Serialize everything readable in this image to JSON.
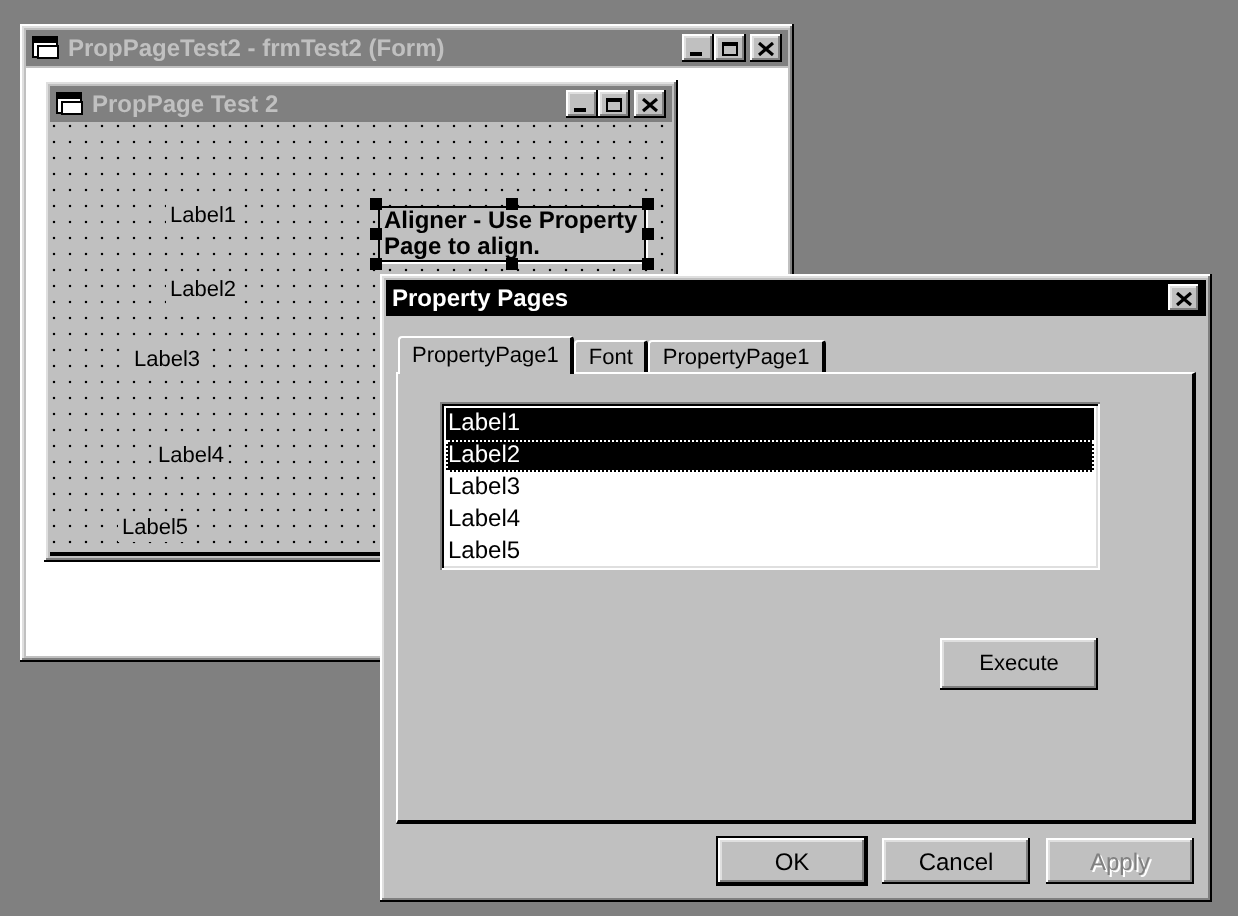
{
  "project_window": {
    "title": "PropPageTest2 - frmTest2 (Form)",
    "active": false
  },
  "form_window": {
    "title": "PropPage Test 2",
    "active": false,
    "labels": [
      {
        "text": "Label1"
      },
      {
        "text": "Label2"
      },
      {
        "text": "Label3"
      },
      {
        "text": "Label4"
      },
      {
        "text": "Label5"
      }
    ],
    "selected_control": {
      "text": "Aligner - Use Property Page to align.",
      "selected": true
    }
  },
  "dialog": {
    "title": "Property Pages",
    "active": true,
    "tabs": [
      {
        "label": "PropertyPage1",
        "selected": true
      },
      {
        "label": "Font",
        "selected": false
      },
      {
        "label": "PropertyPage1",
        "selected": false
      }
    ],
    "list_items": [
      {
        "text": "Label1",
        "selected": true,
        "focused": false
      },
      {
        "text": "Label2",
        "selected": true,
        "focused": true
      },
      {
        "text": "Label3",
        "selected": false,
        "focused": false
      },
      {
        "text": "Label4",
        "selected": false,
        "focused": false
      },
      {
        "text": "Label5",
        "selected": false,
        "focused": false
      }
    ],
    "execute_button": "Execute",
    "buttons": [
      {
        "label": "OK",
        "default": true,
        "disabled": false
      },
      {
        "label": "Cancel",
        "default": false,
        "disabled": false
      },
      {
        "label": "Apply",
        "default": false,
        "disabled": true
      }
    ]
  }
}
